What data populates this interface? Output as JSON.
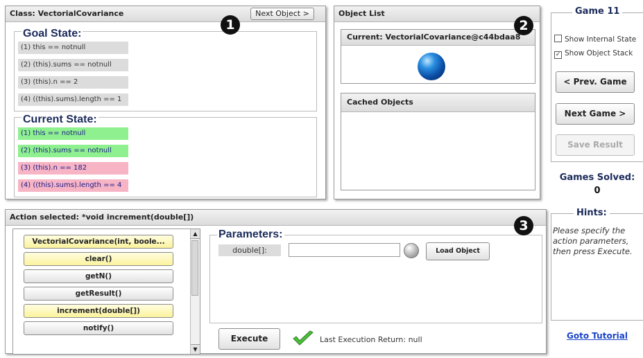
{
  "class_panel": {
    "title": "Class: VectorialCovariance",
    "next_object_label": "Next Object >",
    "badge": "1",
    "goal_title": "Goal State:",
    "goal_conditions": [
      {
        "text": "(1) this == notnull",
        "status": "grey"
      },
      {
        "text": "(2) (this).sums == notnull",
        "status": "grey"
      },
      {
        "text": "(3) (this).n == 2",
        "status": "grey"
      },
      {
        "text": "(4) ((this).sums).length == 1",
        "status": "grey"
      }
    ],
    "current_title": "Current State:",
    "current_conditions": [
      {
        "text": "(1) this == notnull",
        "status": "green"
      },
      {
        "text": "(2) (this).sums == notnull",
        "status": "green"
      },
      {
        "text": "(3) (this).n == 182",
        "status": "pink"
      },
      {
        "text": "(4) ((this).sums).length == 4",
        "status": "pink"
      }
    ],
    "colors": {
      "green": "#8ef08e",
      "pink": "#f6b4c4",
      "grey": "#dcdcdc"
    }
  },
  "object_list": {
    "title": "Object List",
    "badge": "2",
    "current_label": "Current: VectorialCovariance@c44bdaa8",
    "cached_label": "Cached Objects",
    "current_icon": "blue-sphere-icon"
  },
  "sidebar": {
    "game_title": "Game 11",
    "show_internal_state": "Show Internal State",
    "show_internal_checked": false,
    "show_object_stack": "Show Object Stack",
    "show_object_stack_checked": true,
    "prev_game": "< Prev. Game",
    "next_game": "Next Game >",
    "save_result": "Save Result",
    "games_solved_label": "Games Solved:",
    "games_solved_value": "0",
    "hints_title": "Hints:",
    "hints_text": "Please specify the action parameters, then press Execute.",
    "goto_tutorial": "Goto Tutorial"
  },
  "action_panel": {
    "title": "Action selected: *void increment(double[])",
    "badge": "3",
    "methods": [
      {
        "label": "VectorialCovariance(int, boole...",
        "highlight": true
      },
      {
        "label": "clear()",
        "highlight": true
      },
      {
        "label": "getN()",
        "highlight": false
      },
      {
        "label": "getResult()",
        "highlight": false
      },
      {
        "label": "increment(double[])",
        "highlight": true
      },
      {
        "label": "notify()",
        "highlight": false
      }
    ],
    "parameters_title": "Parameters:",
    "param_name": "double[]:",
    "param_value": "",
    "load_object": "Load Object",
    "execute": "Execute",
    "last_return": "Last Execution Return: null"
  }
}
